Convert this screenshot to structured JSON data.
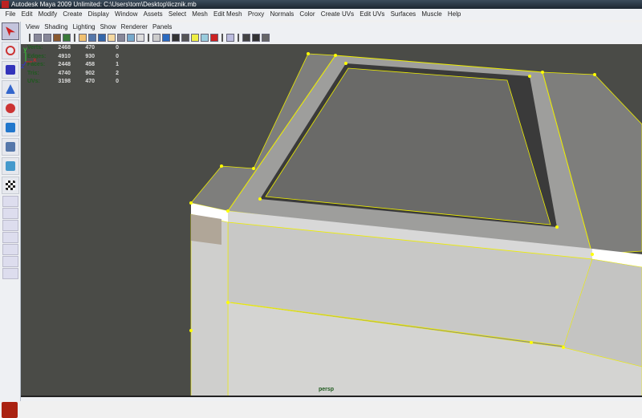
{
  "title": "Autodesk Maya 2009 Unlimited: C:\\Users\\tom\\Desktop\\licznik.mb",
  "menu": [
    "File",
    "Edit",
    "Modify",
    "Create",
    "Display",
    "Window",
    "Assets",
    "Select",
    "Mesh",
    "Edit Mesh",
    "Proxy",
    "Normals",
    "Color",
    "Create UVs",
    "Edit UVs",
    "Surfaces",
    "Muscle",
    "Help"
  ],
  "panel_menu": [
    "View",
    "Shading",
    "Lighting",
    "Show",
    "Renderer",
    "Panels"
  ],
  "hud": [
    {
      "label": "Verts:",
      "values": [
        "2468",
        "470",
        "0"
      ]
    },
    {
      "label": "Edges:",
      "values": [
        "4910",
        "930",
        "0"
      ]
    },
    {
      "label": "Faces:",
      "values": [
        "2448",
        "458",
        "1"
      ]
    },
    {
      "label": "Tris:",
      "values": [
        "4740",
        "902",
        "2"
      ]
    },
    {
      "label": "UVs:",
      "values": [
        "3198",
        "470",
        "0"
      ]
    }
  ],
  "camera": "persp",
  "axes": {
    "x": "x",
    "y": "y",
    "z": "z"
  },
  "colors": {
    "viewport_bg": "#4a4b47",
    "selection": "#ffee00",
    "hud_label": "#1e5a1e"
  }
}
